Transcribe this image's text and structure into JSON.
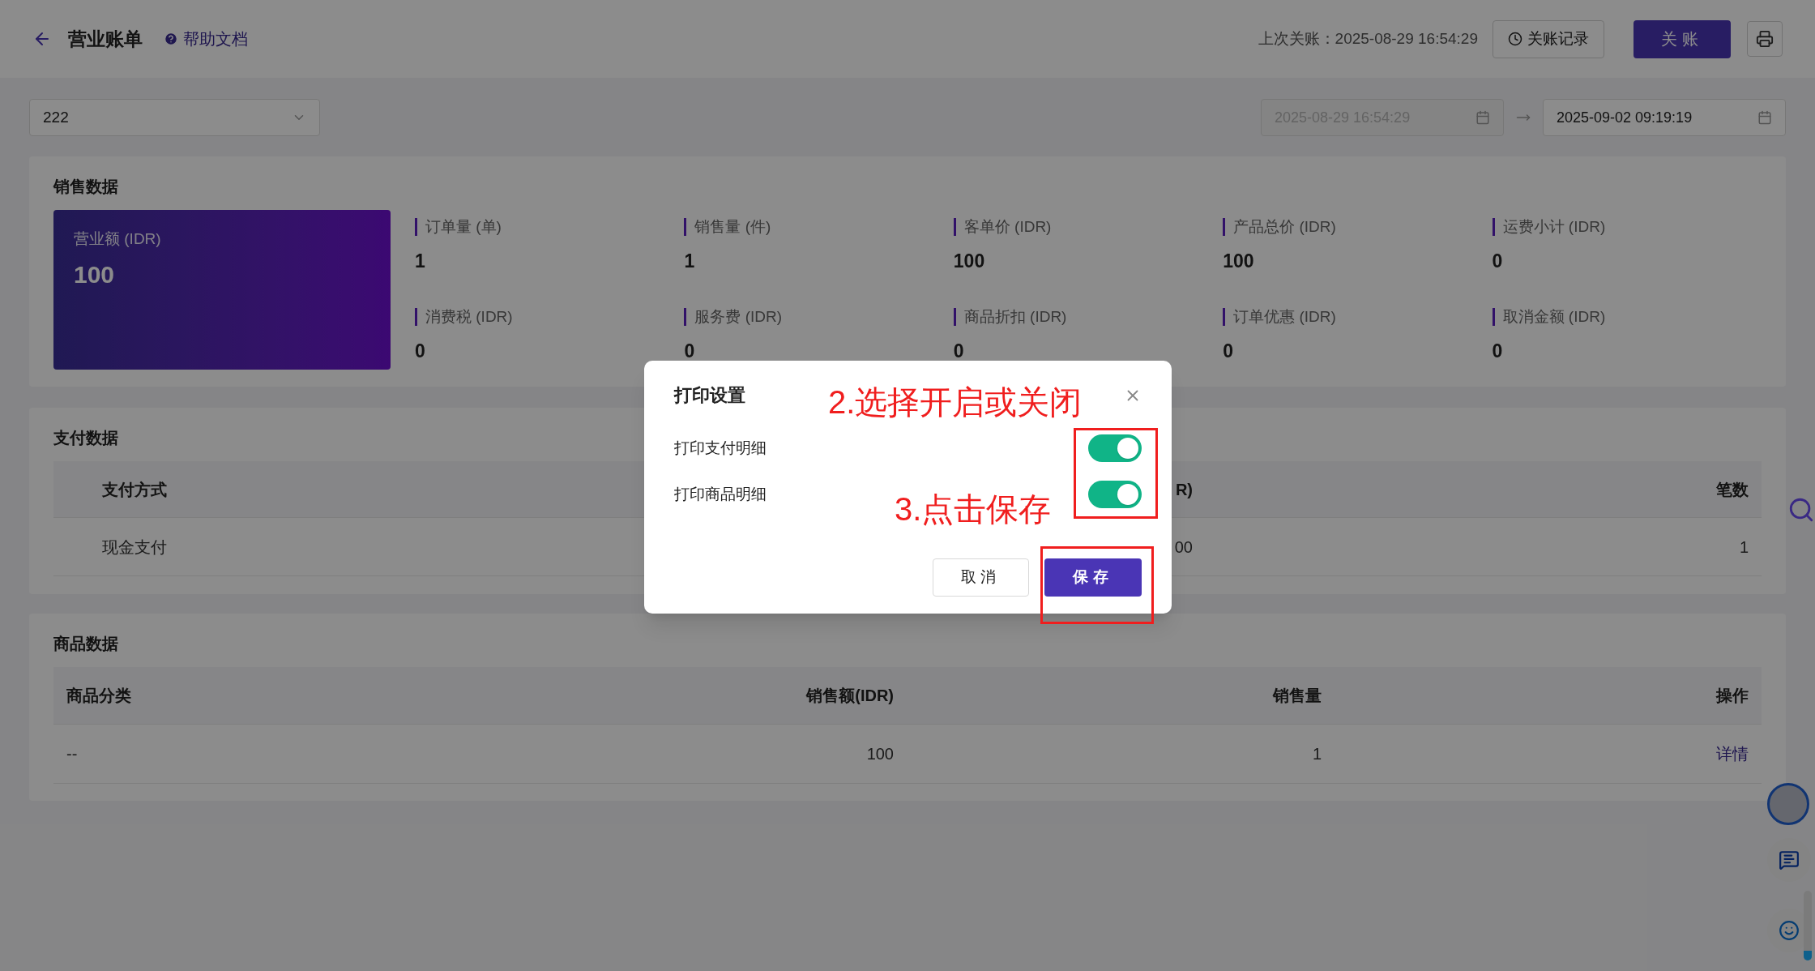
{
  "header": {
    "title": "营业账单",
    "help_link": "帮助文档",
    "last_close": "上次关账：2025-08-29 16:54:29",
    "history_button": "关账记录",
    "close_button": "关账"
  },
  "filters": {
    "store_select": "222",
    "start": {
      "value": "2025-08-29 16:54:29",
      "disabled": true
    },
    "end": {
      "value": "2025-09-02 09:19:19",
      "disabled": false
    }
  },
  "sales": {
    "title": "销售数据",
    "highlight": {
      "label": "营业额 (IDR)",
      "value": "100"
    },
    "metrics": [
      {
        "label": "订单量 (单)",
        "value": "1"
      },
      {
        "label": "销售量 (件)",
        "value": "1"
      },
      {
        "label": "客单价 (IDR)",
        "value": "100"
      },
      {
        "label": "产品总价 (IDR)",
        "value": "100"
      },
      {
        "label": "运费小计 (IDR)",
        "value": "0"
      },
      {
        "label": "消费税 (IDR)",
        "value": "0"
      },
      {
        "label": "服务费 (IDR)",
        "value": "0"
      },
      {
        "label": "商品折扣 (IDR)",
        "value": "0"
      },
      {
        "label": "订单优惠 (IDR)",
        "value": "0"
      },
      {
        "label": "取消金额 (IDR)",
        "value": "0"
      }
    ]
  },
  "payments": {
    "title": "支付数据",
    "columns": [
      "支付方式",
      "R)",
      "笔数"
    ],
    "rows": [
      [
        "现金支付",
        "00",
        "1"
      ]
    ]
  },
  "products": {
    "title": "商品数据",
    "columns": [
      "商品分类",
      "销售额(IDR)",
      "销售量",
      "操作"
    ],
    "rows": [
      {
        "cells": [
          "--",
          "100",
          "1"
        ],
        "action": "详情"
      }
    ]
  },
  "dialog": {
    "title": "打印设置",
    "options": [
      {
        "label": "打印支付明细",
        "on": true
      },
      {
        "label": "打印商品明细",
        "on": true
      }
    ],
    "cancel": "取消",
    "save": "保存"
  },
  "annotations": [
    "2.选择开启或关闭",
    "3.点击保存"
  ]
}
